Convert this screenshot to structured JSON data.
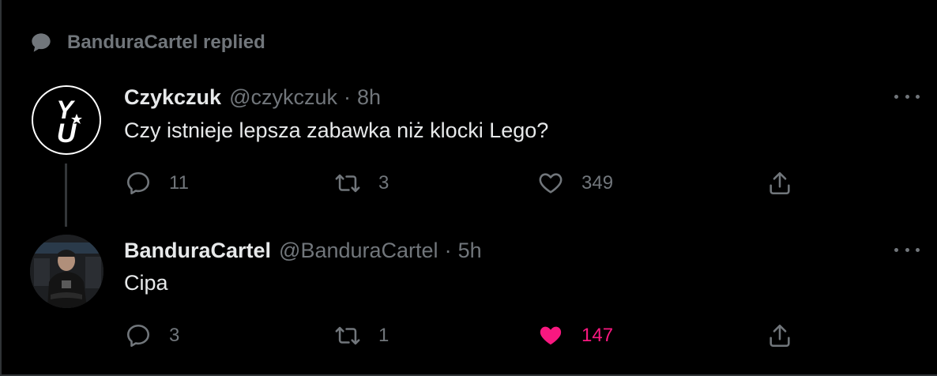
{
  "context": {
    "label": "BanduraCartel replied",
    "icon": "speech-bubble-icon"
  },
  "tweets": [
    {
      "display_name": "Czykczuk",
      "handle": "@czykczuk",
      "separator": "·",
      "time": "8h",
      "text": "Czy istnieje lepsza zabawka niż klocki Lego?",
      "replies": "11",
      "retweets": "3",
      "likes": "349",
      "liked": false
    },
    {
      "display_name": "BanduraCartel",
      "handle": "@BanduraCartel",
      "separator": "·",
      "time": "5h",
      "text": "Cipa",
      "replies": "3",
      "retweets": "1",
      "likes": "147",
      "liked": true
    }
  ],
  "colors": {
    "background": "#000000",
    "primary_text": "#e7e9ea",
    "secondary_text": "#71767b",
    "like_active": "#f91880",
    "divider": "#2f3336"
  }
}
